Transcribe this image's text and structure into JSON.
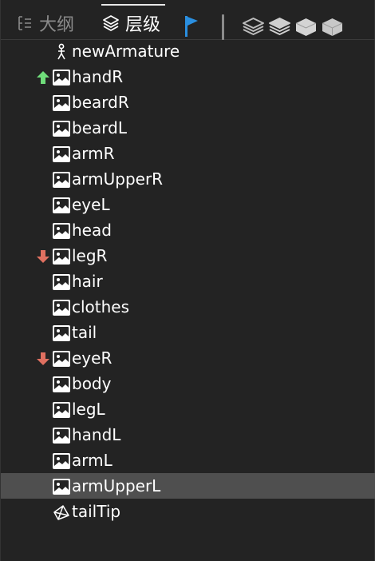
{
  "header": {
    "tab_outline_label": "大纲",
    "tab_layers_label": "层级"
  },
  "tree": {
    "items": [
      {
        "label": "newArmature",
        "icon": "armature-icon",
        "marker": null
      },
      {
        "label": "handR",
        "icon": "image-icon",
        "marker": "up-arrow-icon"
      },
      {
        "label": "beardR",
        "icon": "image-icon",
        "marker": null
      },
      {
        "label": "beardL",
        "icon": "image-icon",
        "marker": null
      },
      {
        "label": "armR",
        "icon": "image-icon",
        "marker": null
      },
      {
        "label": "armUpperR",
        "icon": "image-icon",
        "marker": null
      },
      {
        "label": "eyeL",
        "icon": "image-icon",
        "marker": null
      },
      {
        "label": "head",
        "icon": "image-icon",
        "marker": null
      },
      {
        "label": "legR",
        "icon": "image-icon",
        "marker": "down-arrow-icon"
      },
      {
        "label": "hair",
        "icon": "image-icon",
        "marker": null
      },
      {
        "label": "clothes",
        "icon": "image-icon",
        "marker": null
      },
      {
        "label": "tail",
        "icon": "image-icon",
        "marker": null
      },
      {
        "label": "eyeR",
        "icon": "image-icon",
        "marker": "down-arrow-icon"
      },
      {
        "label": "body",
        "icon": "image-icon",
        "marker": null
      },
      {
        "label": "legL",
        "icon": "image-icon",
        "marker": null
      },
      {
        "label": "handL",
        "icon": "image-icon",
        "marker": null
      },
      {
        "label": "armL",
        "icon": "image-icon",
        "marker": null
      },
      {
        "label": "armUpperL",
        "icon": "image-icon",
        "marker": null,
        "selected": true
      },
      {
        "label": "tailTip",
        "icon": "mesh-icon",
        "marker": null
      }
    ]
  },
  "colors": {
    "background": "#232323",
    "selected_row": "#4f4f4f",
    "up_arrow": "#6fdc7a",
    "down_arrow": "#e07060",
    "flag": "#2a8fe0"
  }
}
